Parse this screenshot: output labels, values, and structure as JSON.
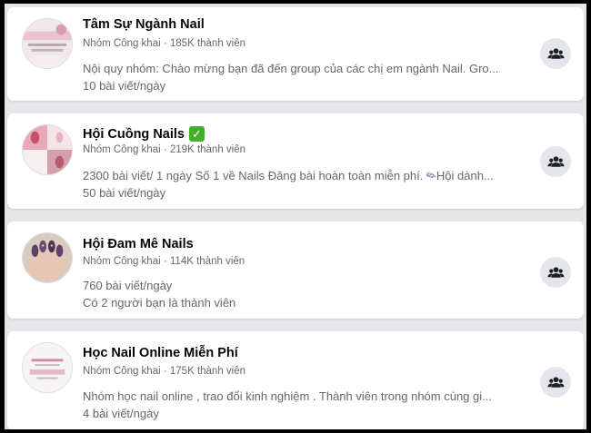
{
  "groups": [
    {
      "name": "Tâm Sự Ngành Nail",
      "privacy": "Nhóm Công khai",
      "members": "185K thành viên",
      "line1": "Nội quy nhóm: Chào mừng bạn đã đến group của các chị em ngành Nail. Gro...",
      "line2": "10 bài viết/ngày"
    },
    {
      "name": "Hội Cuồng Nails",
      "verified_glyph": "✓",
      "privacy": "Nhóm Công khai",
      "members": "219K thành viên",
      "line1_a": "2300 bài viết/ 1 ngày Số 1 về Nails Đăng bài hoàn toàn miễn phí.",
      "line1_b": "Hội dành...",
      "line2": "50 bài viết/ngày"
    },
    {
      "name": "Hội Đam Mê Nails",
      "privacy": "Nhóm Công khai",
      "members": "114K thành viên",
      "line1": "760 bài viết/ngày",
      "line2": "Có 2 người bạn là thành viên"
    },
    {
      "name": "Học Nail Online Miễn Phí",
      "privacy": "Nhóm Công khai",
      "members": "175K thành viên",
      "line1": "Nhóm học nail online , trao đổi kinh nghiệm . Thành viên trong nhóm cùng gi...",
      "line2": "4 bài viết/ngày"
    }
  ],
  "separator": " · ",
  "icons": {
    "join": "group-people-icon",
    "nail_pen": "nail-polish-brush-icon"
  },
  "colors": {
    "name": "#050505",
    "secondary": "#65676b",
    "button_bg": "#e4e6eb",
    "verified": "#43b02a"
  }
}
